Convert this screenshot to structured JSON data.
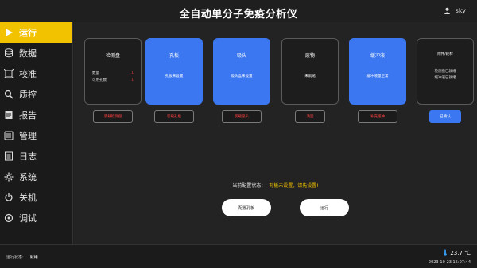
{
  "header": {
    "title": "全自动单分子免疫分析仪",
    "user": "sky"
  },
  "sidebar": {
    "items": [
      {
        "label": "运行",
        "icon": "play-icon",
        "active": true
      },
      {
        "label": "数据",
        "icon": "database-icon"
      },
      {
        "label": "校准",
        "icon": "calibrate-icon"
      },
      {
        "label": "质控",
        "icon": "quality-control-icon"
      },
      {
        "label": "报告",
        "icon": "report-icon"
      },
      {
        "label": "管理",
        "icon": "manage-icon"
      },
      {
        "label": "日志",
        "icon": "log-icon"
      },
      {
        "label": "系统",
        "icon": "settings-icon"
      },
      {
        "label": "关机",
        "icon": "power-icon"
      },
      {
        "label": "调试",
        "icon": "debug-icon"
      }
    ]
  },
  "cards": [
    {
      "title": "检测盘",
      "rows": [
        {
          "k": "数量",
          "v": "1"
        },
        {
          "k": "可用孔数",
          "v": "1"
        }
      ],
      "button": "装载检测盘"
    },
    {
      "title": "孔板",
      "sub": "孔板未设置",
      "button": "装载孔板"
    },
    {
      "title": "吸头",
      "sub": "吸头盒未设置",
      "button": "装载吸头"
    },
    {
      "title": "废物",
      "sub": "未就绪",
      "button": "清空"
    },
    {
      "title": "缓冲液",
      "sub": "缓冲液量正常",
      "button": "补充缓冲"
    },
    {
      "title": "附件/耗材",
      "lines": [
        "检测盘已就绪",
        "缓冲液已就绪"
      ],
      "button": "已确认"
    }
  ],
  "status": {
    "label": "当前配置状态：",
    "value": "孔板未设置，请先设置!"
  },
  "actions": {
    "config": "配置孔板",
    "run": "运行"
  },
  "footer": {
    "run_status_label": "运行状态:",
    "run_status_value": "就绪",
    "temperature": "23.7 ℃",
    "datetime": "2023-10-23 15:07:44"
  },
  "colors": {
    "accent": "#f2c200",
    "blue": "#3b77f0",
    "warning": "#ff4040"
  }
}
